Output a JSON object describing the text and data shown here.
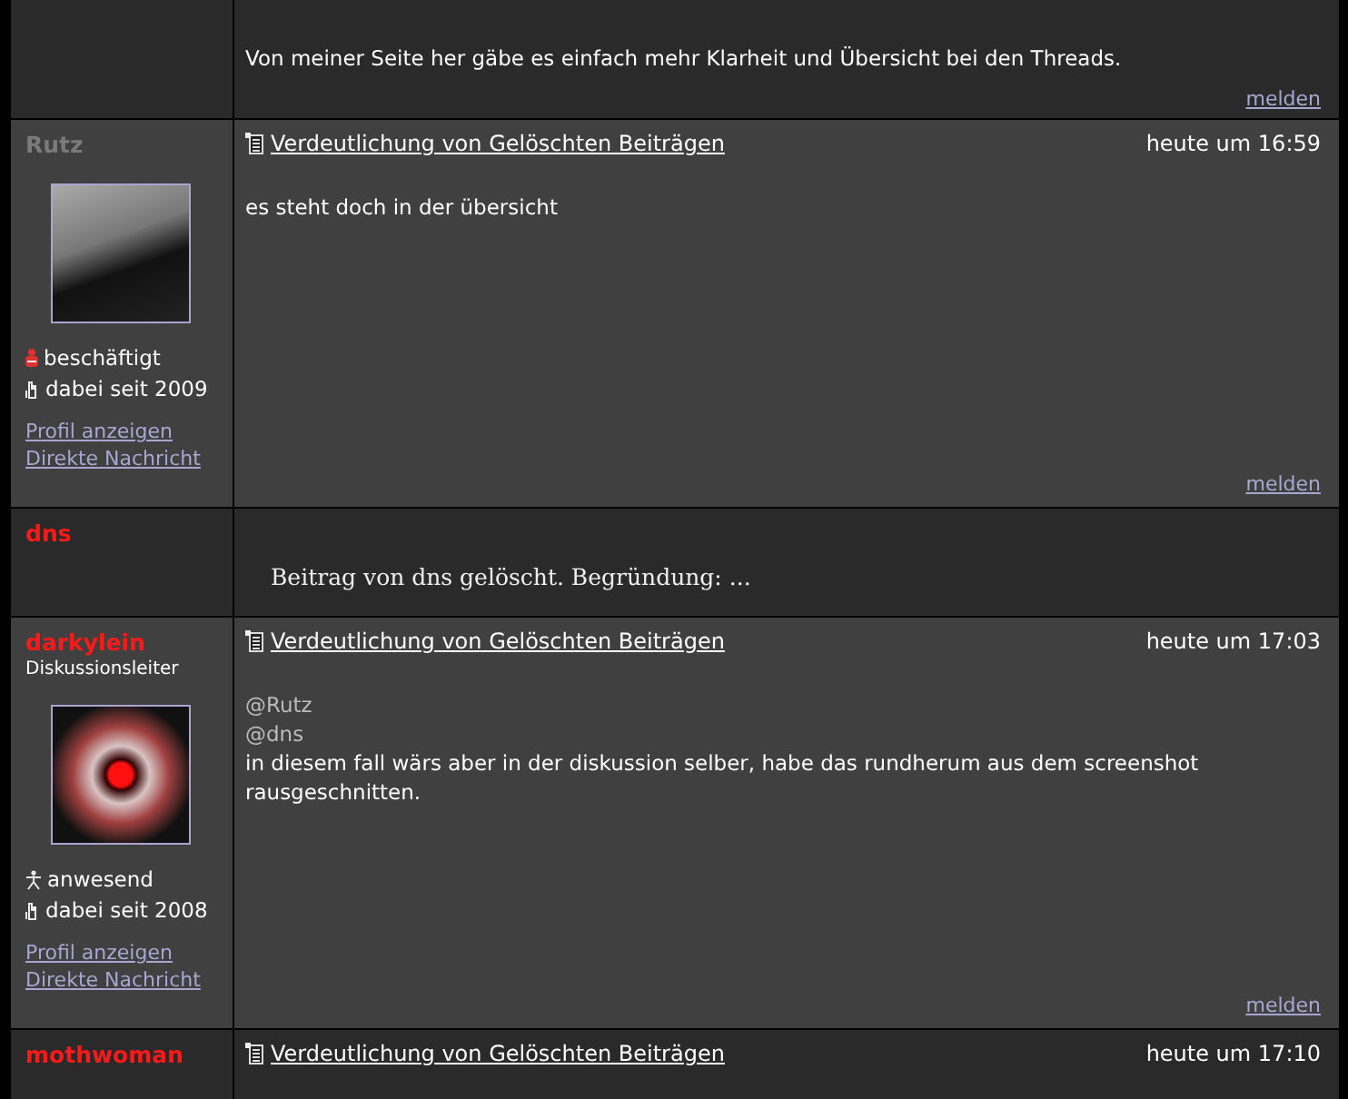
{
  "posts": [
    {
      "kind": "fragment",
      "body": [
        {
          "kind": "text",
          "text": "Von meiner Seite her gäbe es einfach mehr Klarheit und Übersicht bei den Threads."
        }
      ],
      "report": "melden"
    },
    {
      "kind": "post",
      "author": "Rutz",
      "color": "#7a7a7a",
      "avatar": {
        "kind": "grayscale"
      },
      "status": {
        "kind": "busy",
        "text": "beschäftigt"
      },
      "since": "dabei seit 2009",
      "links": [
        "Profil anzeigen",
        "Direkte Nachricht"
      ],
      "title": "Verdeutlichung von Gelöschten Beiträgen",
      "time": "heute um 16:59",
      "body": [
        {
          "kind": "text",
          "text": "es steht doch in der übersicht"
        }
      ],
      "report": "melden"
    },
    {
      "kind": "deleted",
      "author": "dns",
      "color": "#ff1a1a",
      "notice": "Beitrag von dns gelöscht. Begründung: ..."
    },
    {
      "kind": "post",
      "author": "darkylein",
      "color": "#ff1a1a",
      "rank": "Diskussionsleiter",
      "avatar": {
        "kind": "reddish"
      },
      "status": {
        "kind": "present",
        "text": "anwesend"
      },
      "since": "dabei seit 2008",
      "links": [
        "Profil anzeigen",
        "Direkte Nachricht"
      ],
      "title": "Verdeutlichung von Gelöschten Beiträgen",
      "time": "heute um 17:03",
      "body": [
        {
          "kind": "mention",
          "text": "@Rutz"
        },
        {
          "kind": "mention",
          "text": "@dns"
        },
        {
          "kind": "text",
          "text": "in diesem fall wärs aber in der diskussion selber, habe das rundherum aus dem screenshot rausgeschnitten."
        }
      ],
      "report": "melden"
    },
    {
      "kind": "header",
      "author": "mothwoman",
      "color": "#ff1a1a",
      "title": "Verdeutlichung von Gelöschten Beiträgen",
      "time": "heute um 17:10"
    }
  ]
}
